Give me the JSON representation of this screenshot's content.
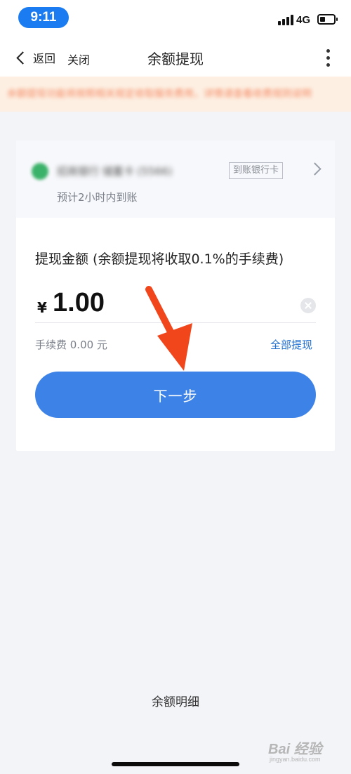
{
  "status_bar": {
    "time": "9:11",
    "network": "4G",
    "battery_level": 0.4
  },
  "nav": {
    "back_label": "返回",
    "close_label": "关闭",
    "title": "余额提现"
  },
  "notice": {
    "text": "余额提现功能将按照相关规定收取服务费用，详情请查看收费规则说明"
  },
  "bank": {
    "name": "招商银行 储蓄卡 (5566)",
    "tag": "到账银行卡",
    "eta": "预计2小时内到账"
  },
  "withdraw": {
    "title": "提现金额 (余额提现将收取0.1%的手续费)",
    "currency_symbol": "¥",
    "amount": "1.00",
    "fee_text": "手续费 0.00 元",
    "withdraw_all_label": "全部提现",
    "next_button_label": "下一步"
  },
  "footer": {
    "details_link": "余额明细"
  },
  "watermark": {
    "text": "Bai 经验",
    "sub": "jingyan.baidu.com"
  },
  "colors": {
    "primary": "#3d82e6",
    "link": "#1f6fd1",
    "notice_bg": "#fdf0e3",
    "notice_text": "#f2754a",
    "annotation_arrow": "#f1461c",
    "time_pill": "#1a7cf0"
  }
}
